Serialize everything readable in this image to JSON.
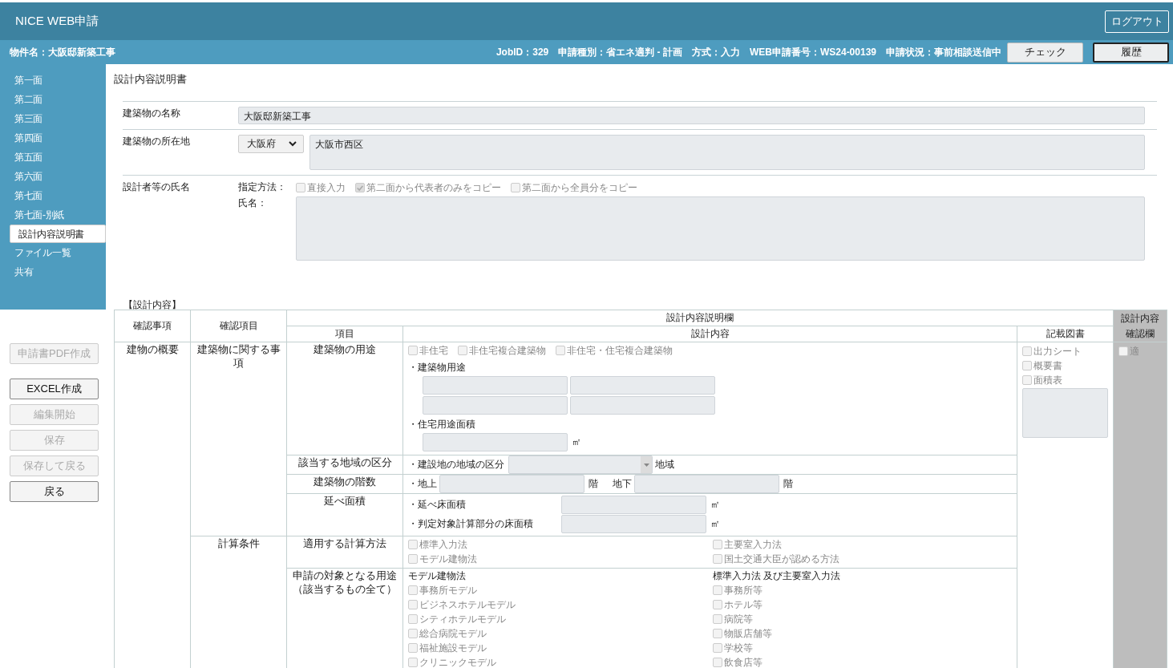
{
  "header": {
    "title": "NICE WEB申請",
    "logout_button": "ログアウト"
  },
  "info_bar": {
    "project": "物件名：大阪邸新築工事",
    "fields": [
      "JobID：329",
      "申請種別：省エネ適判 - 計画",
      "方式：入力",
      "WEB申請番号：WS24-00139",
      "申請状況：事前相談送信中"
    ],
    "buttons": [
      {
        "label": "チェック",
        "focused": false
      },
      {
        "label": "履歴",
        "focused": true
      }
    ]
  },
  "sidebar": {
    "items": [
      {
        "label": "第一面",
        "selected": false
      },
      {
        "label": "第二面",
        "selected": false
      },
      {
        "label": "第三面",
        "selected": false
      },
      {
        "label": "第四面",
        "selected": false
      },
      {
        "label": "第五面",
        "selected": false
      },
      {
        "label": "第六面",
        "selected": false
      },
      {
        "label": "第七面",
        "selected": false
      },
      {
        "label": "第七面-別紙",
        "selected": false
      },
      {
        "label": "設計内容説明書",
        "selected": true
      },
      {
        "label": "ファイル一覧",
        "selected": false
      },
      {
        "label": "共有",
        "selected": false
      }
    ],
    "button_groups": [
      [
        {
          "label": "申請書PDF作成",
          "disabled": true
        }
      ],
      [
        {
          "label": "EXCEL作成",
          "disabled": false
        },
        {
          "label": "編集開始",
          "disabled": true
        },
        {
          "label": "保存",
          "disabled": true
        },
        {
          "label": "保存して戻る",
          "disabled": true
        },
        {
          "label": "戻る",
          "disabled": false
        }
      ]
    ]
  },
  "page_title": "設計内容説明書",
  "basic_form": {
    "name": {
      "label": "建築物の名称",
      "value": "大阪邸新築工事"
    },
    "location": {
      "label": "建築物の所在地",
      "prefecture": "大阪府",
      "address": "大阪市西区"
    },
    "designer": {
      "label": "設計者等の氏名",
      "method_label": "指定方法：",
      "name_label": "氏名：",
      "options": [
        {
          "label": "直接入力",
          "checked": false
        },
        {
          "label": "第二面から代表者のみをコピー",
          "checked": true
        },
        {
          "label": "第二面から全員分をコピー",
          "checked": false
        }
      ]
    }
  },
  "design": {
    "section_title": "【設計内容】",
    "headers": {
      "check_matter": "確認事項",
      "check_item": "確認項目",
      "group": "設計内容説明欄",
      "item": "項目",
      "content": "設計内容",
      "documents": "記載図書",
      "confirm": "設計内容確認欄"
    },
    "category": "建物の概要",
    "groups": [
      {
        "name": "建築物に関する事項",
        "rows": [
          {
            "kind": "use",
            "item": [
              "建築物の用途"
            ],
            "options": [
              {
                "label": "非住宅",
                "checked": false
              },
              {
                "label": "非住宅複合建築物",
                "checked": false
              },
              {
                "label": "非住宅・住宅複合建築物",
                "checked": false
              }
            ],
            "use_label": "・建築物用途",
            "residential_label": "・住宅用途面積",
            "unit": "㎡"
          },
          {
            "kind": "region",
            "item": [
              "該当する地域の区分"
            ],
            "label": "・建設地の地域の区分",
            "suffix": "地域"
          },
          {
            "kind": "floors",
            "item": [
              "建築物の階数"
            ],
            "above_label": "・地上",
            "above_unit": "階",
            "below_label": "地下",
            "below_unit": "階"
          },
          {
            "kind": "area",
            "item": [
              "延べ面積"
            ],
            "lines": [
              {
                "label": "・延べ床面積",
                "unit": "㎡"
              },
              {
                "label": "・判定対象計算部分の床面積",
                "unit": "㎡"
              }
            ]
          }
        ]
      },
      {
        "name": "計算条件",
        "rows": [
          {
            "kind": "methods",
            "item": [
              "適用する計算方法"
            ],
            "columns": [
              [
                {
                  "label": "標準入力法",
                  "checked": false
                },
                {
                  "label": "モデル建物法",
                  "checked": false
                }
              ],
              [
                {
                  "label": "主要室入力法",
                  "checked": false
                },
                {
                  "label": "国土交通大臣が認める方法",
                  "checked": false
                }
              ]
            ]
          },
          {
            "kind": "targets",
            "item": [
              "申請の対象となる用途",
              "（該当するもの全て）"
            ],
            "columns": [
              {
                "heading": "モデル建物法",
                "options": [
                  {
                    "label": "事務所モデル",
                    "checked": false
                  },
                  {
                    "label": "ビジネスホテルモデル",
                    "checked": false
                  },
                  {
                    "label": "シティホテルモデル",
                    "checked": false
                  },
                  {
                    "label": "総合病院モデル",
                    "checked": false
                  },
                  {
                    "label": "福祉施設モデル",
                    "checked": false
                  },
                  {
                    "label": "クリニックモデル",
                    "checked": false
                  }
                ]
              },
              {
                "heading": "標準入力法 及び主要室入力法",
                "options": [
                  {
                    "label": "事務所等",
                    "checked": false
                  },
                  {
                    "label": "ホテル等",
                    "checked": false
                  },
                  {
                    "label": "病院等",
                    "checked": false
                  },
                  {
                    "label": "物販店舗等",
                    "checked": false
                  },
                  {
                    "label": "学校等",
                    "checked": false
                  },
                  {
                    "label": "飲食店等",
                    "checked": false
                  }
                ]
              }
            ]
          }
        ]
      }
    ],
    "documents": [
      {
        "label": "出力シート",
        "checked": false
      },
      {
        "label": "概要書",
        "checked": false
      },
      {
        "label": "面積表",
        "checked": false
      }
    ],
    "confirm": {
      "label": "適",
      "checked": false
    }
  }
}
